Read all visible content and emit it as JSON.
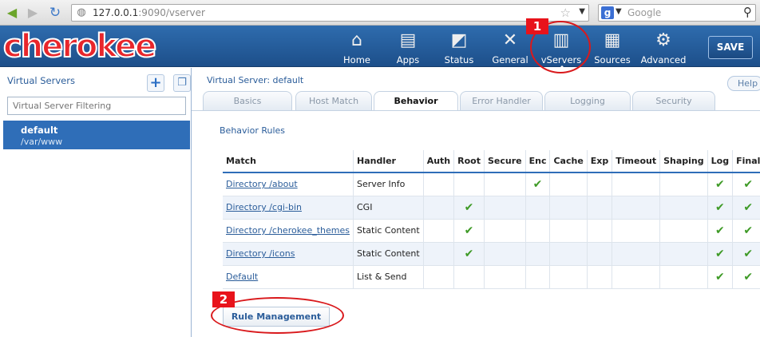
{
  "browser": {
    "url_host": "127.0.0.1",
    "url_rest": ":9090/vserver",
    "search_placeholder": "Google",
    "search_engine_glyph": "g"
  },
  "header": {
    "logo": "cherokee",
    "nav": [
      {
        "label": "Home",
        "icon": "home-icon"
      },
      {
        "label": "Apps",
        "icon": "apps-icon"
      },
      {
        "label": "Status",
        "icon": "status-icon"
      },
      {
        "label": "General",
        "icon": "general-icon"
      },
      {
        "label": "vServers",
        "icon": "vservers-icon"
      },
      {
        "label": "Sources",
        "icon": "sources-icon"
      },
      {
        "label": "Advanced",
        "icon": "advanced-icon"
      }
    ],
    "save_label": "SAVE"
  },
  "annotations": {
    "badge1": "1",
    "badge2": "2"
  },
  "sidebar": {
    "title": "Virtual Servers",
    "filter_placeholder": "Virtual Server Filtering",
    "items": [
      {
        "name": "default",
        "path": "/var/www"
      }
    ]
  },
  "main": {
    "vserver_title": "Virtual Server: default",
    "help_label": "Help",
    "tabs": [
      {
        "label": "Basics",
        "active": false
      },
      {
        "label": "Host Match",
        "active": false
      },
      {
        "label": "Behavior",
        "active": true
      },
      {
        "label": "Error Handler",
        "active": false
      },
      {
        "label": "Logging",
        "active": false
      },
      {
        "label": "Security",
        "active": false
      }
    ],
    "rules_title": "Behavior Rules",
    "columns": [
      "Match",
      "Handler",
      "Auth",
      "Root",
      "Secure",
      "Enc",
      "Cache",
      "Exp",
      "Timeout",
      "Shaping",
      "Log",
      "Final"
    ],
    "rows": [
      {
        "match": "Directory /about",
        "handler": "Server Info",
        "checks": [
          false,
          false,
          false,
          true,
          false,
          false,
          false,
          false,
          true,
          true
        ]
      },
      {
        "match": "Directory /cgi-bin",
        "handler": "CGI",
        "checks": [
          false,
          true,
          false,
          false,
          false,
          false,
          false,
          false,
          true,
          true
        ]
      },
      {
        "match": "Directory /cherokee_themes",
        "handler": "Static Content",
        "checks": [
          false,
          true,
          false,
          false,
          false,
          false,
          false,
          false,
          true,
          true
        ]
      },
      {
        "match": "Directory /icons",
        "handler": "Static Content",
        "checks": [
          false,
          true,
          false,
          false,
          false,
          false,
          false,
          false,
          true,
          true
        ]
      },
      {
        "match": "Default",
        "handler": "List & Send",
        "checks": [
          false,
          false,
          false,
          false,
          false,
          false,
          false,
          false,
          true,
          true
        ]
      }
    ],
    "rule_management_label": "Rule Management"
  }
}
